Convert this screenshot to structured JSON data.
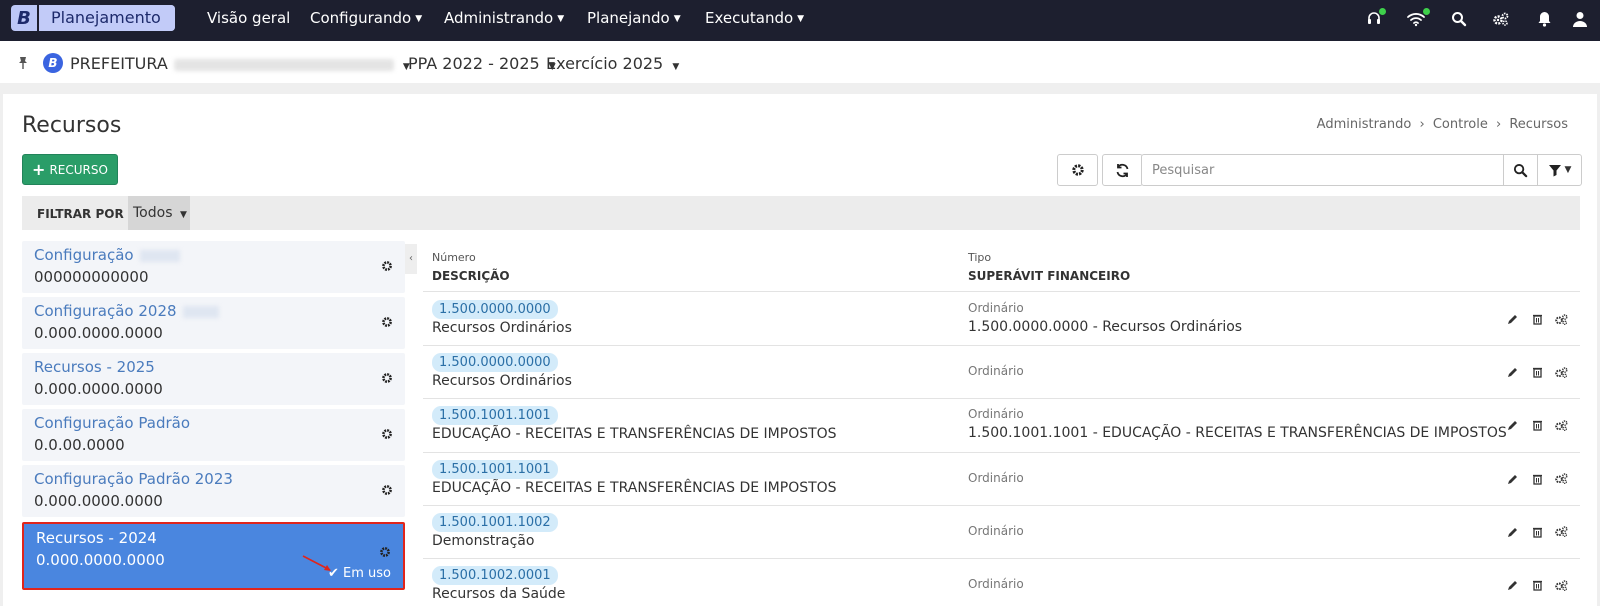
{
  "topnav": {
    "brand_letter": "B",
    "app_name": "Planejamento",
    "menu": [
      {
        "label": "Visão geral"
      },
      {
        "label": "Configurando"
      },
      {
        "label": "Administrando"
      },
      {
        "label": "Planejando"
      },
      {
        "label": "Executando"
      }
    ],
    "icons": [
      "headset-icon",
      "wifi-icon",
      "search-icon",
      "cogs-icon",
      "bell-icon",
      "user-icon"
    ]
  },
  "context": {
    "org_prefix": "PREFEITURA",
    "ppa": "PPA 2022 - 2025",
    "exercicio": "Exercício 2025"
  },
  "page": {
    "title": "Recursos",
    "breadcrumb": [
      "Administrando",
      "Controle",
      "Recursos"
    ],
    "add_button": "RECURSO",
    "search_placeholder": "Pesquisar",
    "filter_label": "FILTRAR POR",
    "filter_value": "Todos"
  },
  "configs": [
    {
      "name": "Configuração",
      "code": "000000000000",
      "selected": false
    },
    {
      "name": "Configuração 2028",
      "code": "0.000.0000.0000",
      "selected": false
    },
    {
      "name": "Recursos - 2025",
      "code": "0.000.0000.0000",
      "selected": false
    },
    {
      "name": "Configuração Padrão",
      "code": "0.0.00.0000",
      "selected": false
    },
    {
      "name": "Configuração Padrão 2023",
      "code": "0.000.0000.0000",
      "selected": false
    },
    {
      "name": "Recursos - 2024",
      "code": "0.000.0000.0000",
      "selected": true,
      "status": "Em uso"
    }
  ],
  "table": {
    "headers": {
      "numero": "Número",
      "descricao": "DESCRIÇÃO",
      "tipo": "Tipo",
      "superavit": "SUPERÁVIT FINANCEIRO"
    },
    "rows": [
      {
        "numero": "1.500.0000.0000",
        "descricao": "Recursos Ordinários",
        "tipo": "Ordinário",
        "superavit": "1.500.0000.0000 - Recursos Ordinários"
      },
      {
        "numero": "1.500.0000.0000",
        "descricao": "Recursos Ordinários",
        "tipo": "Ordinário",
        "superavit": ""
      },
      {
        "numero": "1.500.1001.1001",
        "descricao": "EDUCAÇÃO - RECEITAS E TRANSFERÊNCIAS DE IMPOSTOS",
        "tipo": "Ordinário",
        "superavit": "1.500.1001.1001 - EDUCAÇÃO - RECEITAS E TRANSFERÊNCIAS DE IMPOSTOS"
      },
      {
        "numero": "1.500.1001.1001",
        "descricao": "EDUCAÇÃO - RECEITAS E TRANSFERÊNCIAS DE IMPOSTOS",
        "tipo": "Ordinário",
        "superavit": ""
      },
      {
        "numero": "1.500.1001.1002",
        "descricao": "Demonstração",
        "tipo": "Ordinário",
        "superavit": ""
      },
      {
        "numero": "1.500.1002.0001",
        "descricao": "Recursos da Saúde",
        "tipo": "Ordinário",
        "superavit": ""
      }
    ]
  },
  "colors": {
    "nav_bg": "#1d1f2f",
    "accent_green": "#2a9d68",
    "selected_blue": "#4a86df",
    "highlight_red": "#e0251b"
  }
}
